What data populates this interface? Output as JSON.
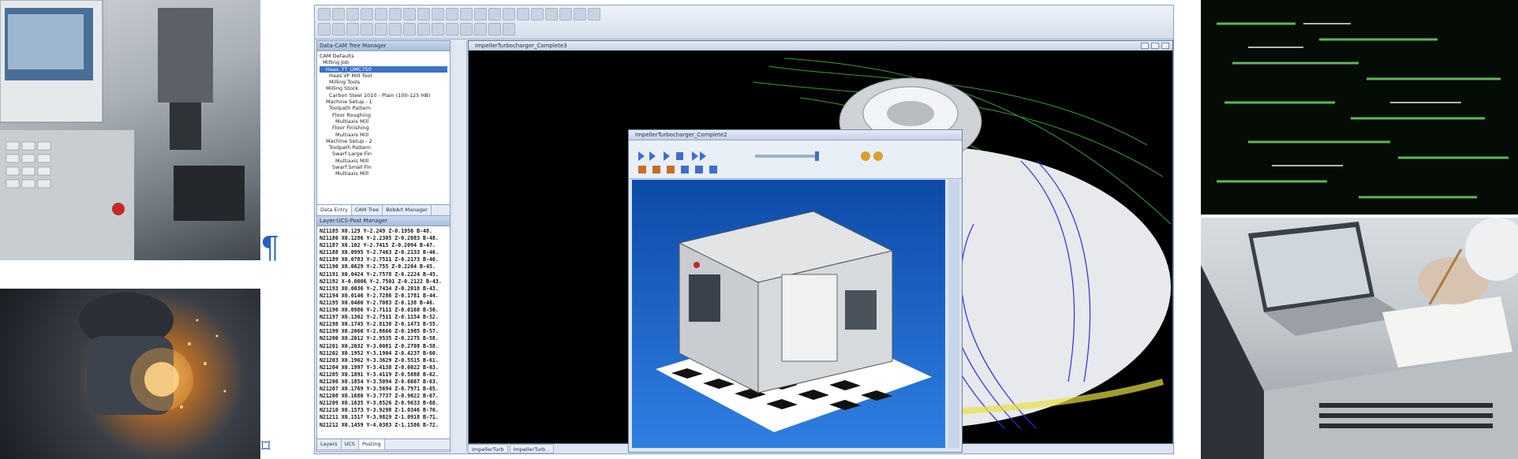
{
  "markers": {
    "pilcrow": "¶",
    "anchor": "⌑"
  },
  "cam": {
    "tree_manager_title": "Data-CAM Tree Manager",
    "tree_items": [
      "CAM Defaults",
      "Milling Job",
      "Haas_TT_UMC750",
      "Haas VF Mill Tool",
      "Milling Tools",
      "Milling Stock",
      "Carbon Steel 1010 - Plain (100-125 HB)",
      "Machine Setup - 1",
      "Toolpath Pattern",
      "Floor Roughing",
      "Multiaxis Mill",
      "Floor Finishing",
      "Multiaxis Mill",
      "Machine Setup - 2",
      "Toolpath Pattern",
      "Swarf Large Fin",
      "Multiaxis Mill",
      "Swarf Small Fin",
      "Multiaxis Mill"
    ],
    "panel_tabs": [
      "Data Entry",
      "CAM Tree",
      "BobArt Manager"
    ],
    "post_manager_title": "Layer-UCS-Post Manager",
    "post_lines": [
      "N21185 X0.129 Y-2.249 Z-0.1956 B-48.",
      "N21186 X0.1286 Y-2.2305 Z-0.2083 B-48.",
      "N21187 X0.102 Y-2.7415 Z-0.2094 B-47.",
      "N21188 X0.0995 Y-2.7463 Z-0.2133 B-46.",
      "N21189 X0.0783 Y-2.7511 Z-0.2173 B-46.",
      "N21190 X0.0629 Y-2.755 Z-0.2204 B-45.",
      "N21191 X0.0424 Y-2.7578 Z-0.2224 B-45.",
      "N21192 X-0.0006 Y-2.7501 Z-0.2122 B-43.",
      "N21193 X0.0036 Y-2.7434 Z-0.2018 B-43.",
      "N21194 X0.0146 Y-2.7286 Z-0.1781 B-44.",
      "N21195 X0.0400 Y-2.7083 Z-0.138 B-46.",
      "N21196 X0.0986 Y-2.7111 Z-0.0168 B-50.",
      "N21197 X0.1302 Y-2.7511 Z-0.1154 B-52.",
      "N21198 X0.1745 Y-2.8138 Z-0.1473 B-55.",
      "N21199 X0.2060 Y-2.8666 Z-0.1985 B-57.",
      "N21200 X0.2012 Y-2.9535 Z-0.2275 B-58.",
      "N21201 X0.2032 Y-3.0081 Z-0.2708 B-58.",
      "N21202 X0.1952 Y-3.1904 Z-0.4237 B-60.",
      "N21203 X0.1962 Y-3.3629 Z-0.5515 B-61.",
      "N21204 X0.1997 Y-3.4138 Z-0.6022 B-63.",
      "N21205 X0.1891 Y-3.4119 Z-0.5888 B-62.",
      "N21206 X0.1854 Y-3.5094 Z-0.6667 B-63.",
      "N21207 X0.1769 Y-3.5694 Z-0.7971 B-65.",
      "N21208 X0.1686 Y-3.7737 Z-0.9022 B-67.",
      "N21209 X0.1635 Y-3.8526 Z-0.9633 B-68.",
      "N21210 X0.1573 Y-3.9298 Z-1.0346 B-70.",
      "N21211 X0.1517 Y-3.9829 Z-1.0918 B-71.",
      "N21212 X0.1459 Y-4.0383 Z-1.1586 B-72."
    ],
    "bottom_tabs": [
      "Layers",
      "UCS",
      "Posting"
    ],
    "main_view_title": "ImpellerTurbocharger_Complete3",
    "inner_view_title": "ImpellerTurbocharger_Complete2",
    "view_tabs": [
      "ImpellerTurb",
      "ImpellerTurb..."
    ]
  }
}
